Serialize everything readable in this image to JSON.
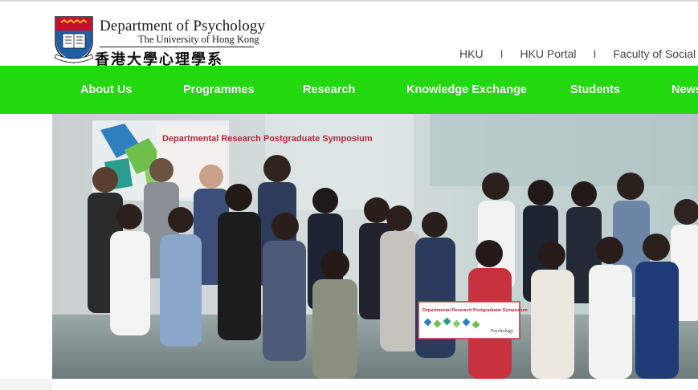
{
  "header": {
    "dept_name": "Department of Psychology",
    "university_name": "The University of Hong Kong",
    "chinese_name": "香港大學心理學系",
    "crest_motto": "SAPIENTIA ET VIRTUS",
    "top_links": [
      "HKU",
      "HKU Portal",
      "Faculty of Social"
    ],
    "separator": "I"
  },
  "nav": {
    "items": [
      "About Us",
      "Programmes",
      "Research",
      "Knowledge Exchange",
      "Students",
      "News"
    ]
  },
  "hero": {
    "poster_text": "Departmental Research Postgraduate Symposium",
    "banner_text": "Departmental Research Postgraduate Symposium",
    "banner_logo_text": "Psychology"
  },
  "colors": {
    "nav_green": "#22d80f",
    "crest_red": "#c8102e",
    "crest_gold": "#e5b81e"
  }
}
